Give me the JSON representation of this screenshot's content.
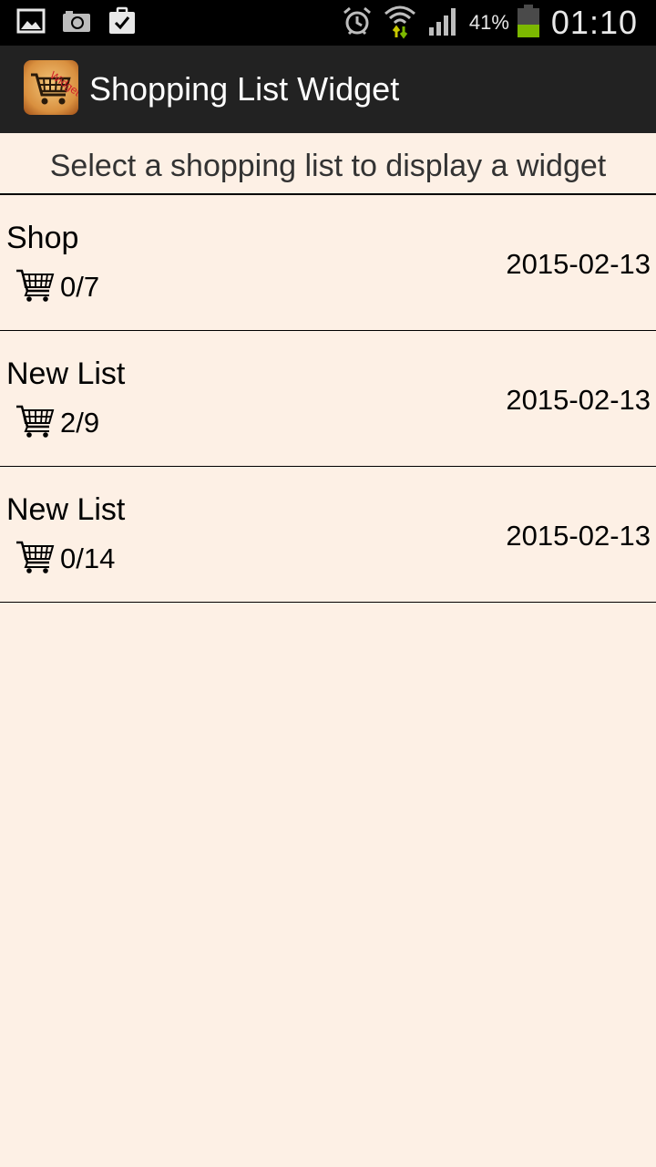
{
  "status_bar": {
    "left_icons": [
      "gallery-icon",
      "camera-icon",
      "clipboard-check-icon"
    ],
    "right_icons": [
      "alarm-icon",
      "wifi-icon",
      "signal-icon",
      "battery-icon"
    ],
    "battery_percent": "41%",
    "time": "01:10",
    "battery_color": "#7cb800"
  },
  "action_bar": {
    "title": "Shopping List Widget",
    "logo_icon": "shopping-cart-widget-logo",
    "logo_text": "Widget"
  },
  "prompt": "Select a shopping list to display a widget",
  "lists": [
    {
      "name": "Shop",
      "count": "0/7",
      "date": "2015-02-13"
    },
    {
      "name": "New List",
      "count": "2/9",
      "date": "2015-02-13"
    },
    {
      "name": "New List",
      "count": "0/14",
      "date": "2015-02-13"
    }
  ],
  "colors": {
    "background": "#fdf0e5",
    "action_bar": "#222222",
    "status_bar": "#000000"
  }
}
